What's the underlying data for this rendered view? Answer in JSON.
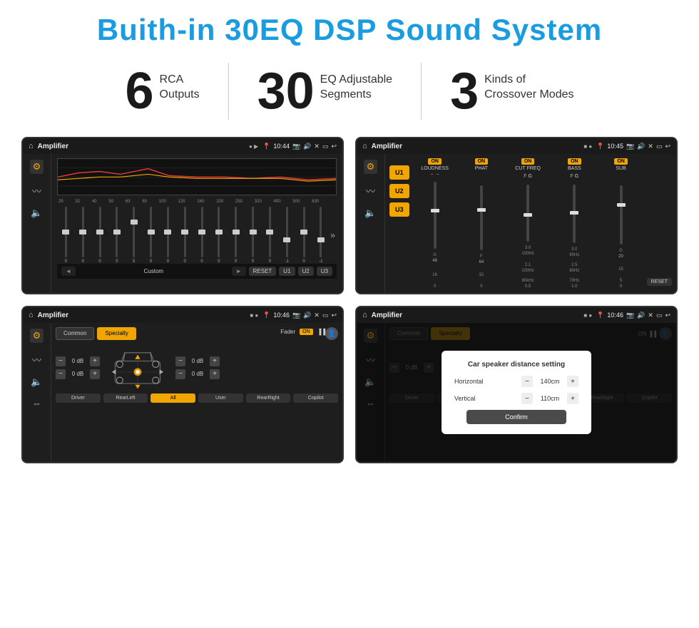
{
  "header": {
    "title": "Buith-in 30EQ DSP Sound System"
  },
  "stats": [
    {
      "number": "6",
      "label": "RCA\nOutputs"
    },
    {
      "number": "30",
      "label": "EQ Adjustable\nSegments"
    },
    {
      "number": "3",
      "label": "Kinds of\nCrossover Modes"
    }
  ],
  "screens": [
    {
      "id": "screen-eq",
      "statusBar": {
        "title": "Amplifier",
        "time": "10:44"
      },
      "type": "equalizer"
    },
    {
      "id": "screen-amp",
      "statusBar": {
        "title": "Amplifier",
        "time": "10:45"
      },
      "type": "amplifier"
    },
    {
      "id": "screen-specialty",
      "statusBar": {
        "title": "Amplifier",
        "time": "10:46"
      },
      "type": "specialty"
    },
    {
      "id": "screen-dialog",
      "statusBar": {
        "title": "Amplifier",
        "time": "10:46"
      },
      "type": "dialog"
    }
  ],
  "eq": {
    "frequencies": [
      "25",
      "32",
      "40",
      "50",
      "63",
      "80",
      "100",
      "125",
      "160",
      "200",
      "250",
      "320",
      "400",
      "500",
      "630"
    ],
    "values": [
      "0",
      "0",
      "0",
      "0",
      "5",
      "0",
      "0",
      "0",
      "0",
      "0",
      "0",
      "0",
      "0",
      "-1",
      "0",
      "-1"
    ],
    "thumbPositions": [
      50,
      50,
      50,
      50,
      30,
      50,
      50,
      50,
      50,
      50,
      50,
      50,
      50,
      65,
      50,
      65
    ],
    "presetLabel": "Custom",
    "buttons": [
      "RESET",
      "U1",
      "U2",
      "U3"
    ]
  },
  "amplifier": {
    "uButtons": [
      "U1",
      "U2",
      "U3"
    ],
    "channels": [
      {
        "label": "LOUDNESS",
        "on": true
      },
      {
        "label": "PHAT",
        "on": true
      },
      {
        "label": "CUT FREQ",
        "on": true
      },
      {
        "label": "BASS",
        "on": true
      },
      {
        "label": "SUB",
        "on": true
      }
    ],
    "resetLabel": "RESET"
  },
  "specialty": {
    "tabs": [
      "Common",
      "Specialty"
    ],
    "activeTab": "Specialty",
    "fader": {
      "label": "Fader",
      "on": true
    },
    "volumes": [
      "0 dB",
      "0 dB",
      "0 dB",
      "0 dB"
    ],
    "bottomButtons": [
      "Driver",
      "RearLeft",
      "All",
      "User",
      "RearRight",
      "Copilot"
    ]
  },
  "dialog": {
    "title": "Car speaker distance setting",
    "horizontal": {
      "label": "Horizontal",
      "value": "140cm"
    },
    "vertical": {
      "label": "Vertical",
      "value": "110cm"
    },
    "confirmLabel": "Confirm",
    "tabs": [
      "Common",
      "Specialty"
    ],
    "volumes": [
      "0 dB",
      "0 dB"
    ]
  }
}
